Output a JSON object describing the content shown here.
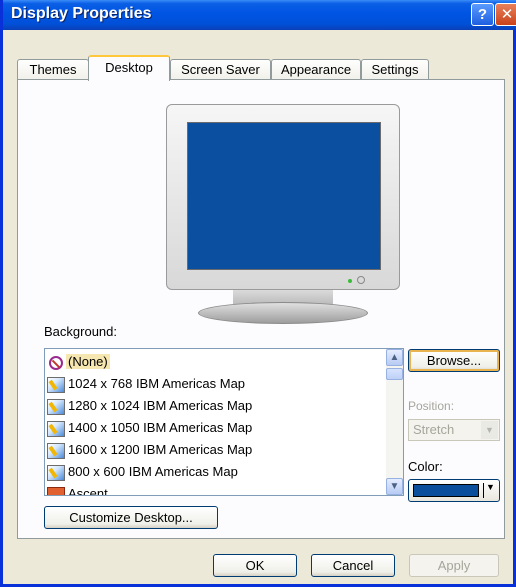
{
  "window": {
    "title": "Display Properties",
    "help_label": "?",
    "close_label": "✕"
  },
  "tabs": [
    {
      "label": "Themes"
    },
    {
      "label": "Desktop"
    },
    {
      "label": "Screen Saver"
    },
    {
      "label": "Appearance"
    },
    {
      "label": "Settings"
    }
  ],
  "active_tab": "Desktop",
  "desktop": {
    "background_label": "Background:",
    "backgrounds": [
      {
        "label": "(None)",
        "icon": "none-icon",
        "selected": true
      },
      {
        "label": "1024 x 768 IBM Americas Map",
        "icon": "image-icon"
      },
      {
        "label": "1280 x 1024 IBM Americas Map",
        "icon": "image-icon"
      },
      {
        "label": "1400 x 1050 IBM Americas Map",
        "icon": "image-icon"
      },
      {
        "label": "1600 x 1200 IBM Americas Map",
        "icon": "image-icon"
      },
      {
        "label": "800 x 600 IBM Americas Map",
        "icon": "image-icon"
      },
      {
        "label": "Ascent",
        "icon": "image-icon"
      }
    ],
    "browse_label": "Browse...",
    "position_label": "Position:",
    "position_value": "Stretch",
    "color_label": "Color:",
    "color_value": "#0b4f9c",
    "customize_label": "Customize Desktop..."
  },
  "buttons": {
    "ok": "OK",
    "cancel": "Cancel",
    "apply": "Apply"
  },
  "colors": {
    "monitor_screen": "#0a4fa0",
    "titlebar": "#0054e3"
  }
}
